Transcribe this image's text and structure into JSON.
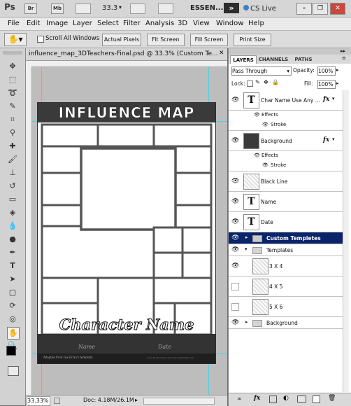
{
  "app": {
    "logo": "Ps",
    "bar": {
      "bridge": "Br",
      "minibridge": "Mb",
      "zoom": "33.3",
      "workspace": "ESSEN...",
      "more": "»",
      "cs_live": "CS Live"
    }
  },
  "menu": [
    "File",
    "Edit",
    "Image",
    "Layer",
    "Select",
    "Filter",
    "Analysis",
    "3D",
    "View",
    "Window",
    "Help"
  ],
  "options": {
    "scroll_all": "Scroll All Windows",
    "actual_pixels": "Actual Pixels",
    "fit_screen": "Fit Screen",
    "fill_screen": "Fill Screen",
    "print_size": "Print Size"
  },
  "document": {
    "title": "influence_map_3DTeachers-Final.psd @ 33.3% (Custom Te...",
    "zoom": "33.33%",
    "doc_size": "Doc: 4.18M/26.1M"
  },
  "artwork": {
    "heading": "INFLUENCE MAP",
    "character_name": "Character Name",
    "name_label": "Name",
    "date_label": "Date",
    "credit": "Adapted from Fox-Orian's template",
    "small_credit": "icons by fox-orian | fox-orian.deviantart.com"
  },
  "panel": {
    "tabs": [
      "LAYERS",
      "CHANNELS",
      "PATHS"
    ],
    "blend_mode": "Pass Through",
    "opacity_label": "Opacity:",
    "opacity_value": "100%",
    "lock_label": "Lock:",
    "fill_label": "Fill:",
    "fill_value": "100%",
    "layers": [
      {
        "name": "Char Name Use Any ...",
        "fx": "fx"
      },
      {
        "name": "Effects"
      },
      {
        "name": "Stroke"
      },
      {
        "name": "Background",
        "fx": "fx"
      },
      {
        "name": "Effects"
      },
      {
        "name": "Stroke"
      },
      {
        "name": "Black Line"
      },
      {
        "name": "Name"
      },
      {
        "name": "Date"
      },
      {
        "name": "Custom Templetes"
      },
      {
        "name": "Templates"
      },
      {
        "name": "3 X 4"
      },
      {
        "name": "4 X 5"
      },
      {
        "name": "5 X 6"
      },
      {
        "name": "Background"
      }
    ]
  }
}
